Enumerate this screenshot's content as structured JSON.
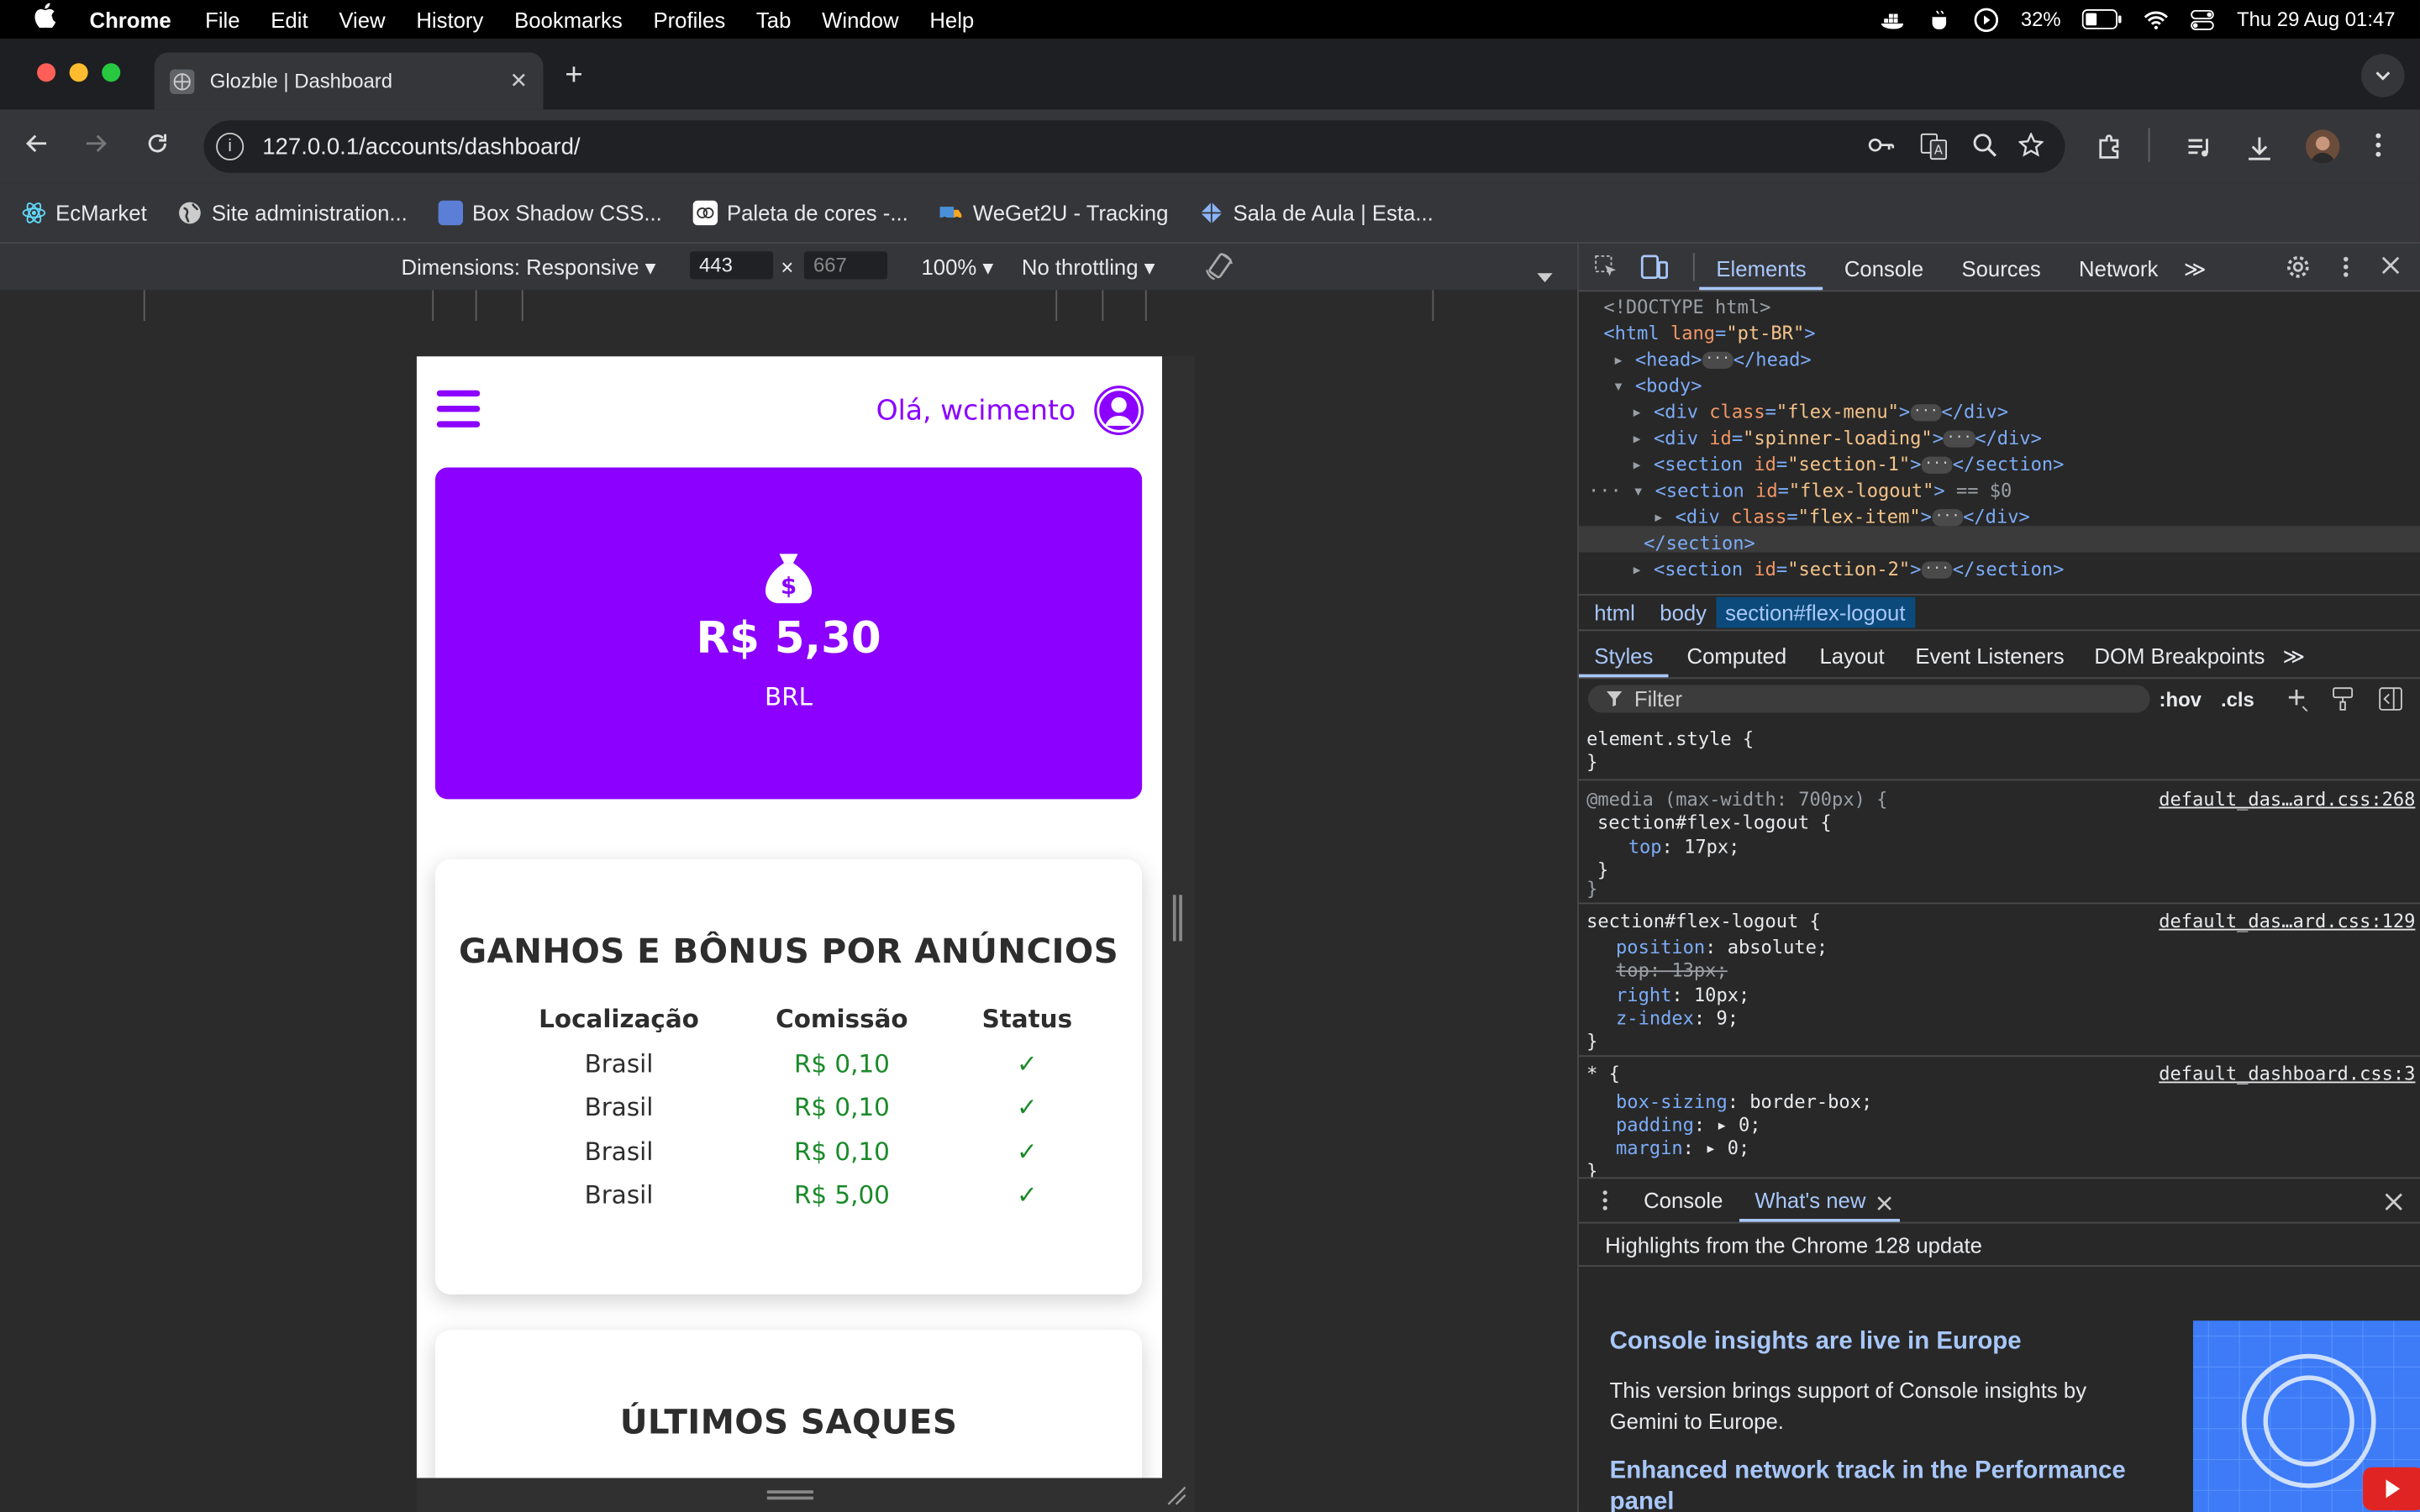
{
  "menubar": {
    "app": "Chrome",
    "items": [
      "File",
      "Edit",
      "View",
      "History",
      "Bookmarks",
      "Profiles",
      "Tab",
      "Window",
      "Help"
    ],
    "battery": "32%",
    "datetime": "Thu 29 Aug  01:47"
  },
  "tab": {
    "title": "Glozble | Dashboard",
    "close": "✕",
    "new": "+"
  },
  "address": {
    "url": "127.0.0.1/accounts/dashboard/"
  },
  "bookmarks": [
    "EcMarket",
    "Site administration...",
    "Box Shadow CSS...",
    "Paleta de cores -...",
    "WeGet2U - Tracking",
    "Sala de Aula | Esta..."
  ],
  "device_toolbar": {
    "dimensions": "Dimensions: Responsive ▾",
    "width": "443",
    "times": "×",
    "height": "667",
    "zoom": "100% ▾",
    "throttle": "No throttling ▾"
  },
  "site": {
    "greeting": "Olá, wcimento",
    "balance": {
      "amount": "R$ 5,30",
      "currency": "BRL"
    },
    "earnings": {
      "title": "GANHOS E BÔNUS POR ANÚNCIOS",
      "headers": [
        "Localização",
        "Comissão",
        "Status"
      ],
      "rows": [
        [
          "Brasil",
          "R$ 0,10",
          "✓"
        ],
        [
          "Brasil",
          "R$ 0,10",
          "✓"
        ],
        [
          "Brasil",
          "R$ 0,10",
          "✓"
        ],
        [
          "Brasil",
          "R$ 5,00",
          "✓"
        ]
      ]
    },
    "withdrawals": {
      "title": "ÚLTIMOS SAQUES"
    }
  },
  "devtools": {
    "tabs": [
      "Elements",
      "Console",
      "Sources",
      "Network",
      "≫"
    ],
    "dom": [
      "<!DOCTYPE html>",
      "<html lang=\"pt-BR\">",
      "<head> … </head>",
      "<body>",
      "<div class=\"flex-menu\"> … </div>",
      "<div id=\"spinner-loading\"> … </div>",
      "<section id=\"section-1\"> … </section>",
      "<section id=\"flex-logout\"> == $0",
      "<div class=\"flex-item\"> … </div>",
      "</section>",
      "<section id=\"section-2\"> … </section>"
    ],
    "breadcrumbs": [
      "html",
      "body",
      "section#flex-logout"
    ],
    "subtabs": [
      "Styles",
      "Computed",
      "Layout",
      "Event Listeners",
      "DOM Breakpoints",
      "≫"
    ],
    "filter_placeholder": "Filter",
    "hov": ":hov",
    "cls": ".cls",
    "styles": {
      "element_style": "element.style {",
      "media": "@media (max-width: 700px) {",
      "media_rule": "section#flex-logout {",
      "media_prop": "top: 17px;",
      "media_src": "default_das…ard.css:268",
      "rule2": "section#flex-logout {",
      "rule2_props": [
        "position: absolute;",
        "top: 13px;",
        "right: 10px;",
        "z-index: 9;"
      ],
      "rule2_src": "default_das…ard.css:129",
      "rule3": "* {",
      "rule3_props": [
        "box-sizing: border-box;",
        "padding: ▸ 0;",
        "margin: ▸ 0;"
      ],
      "rule3_src": "default_dashboard.css:3"
    },
    "drawer": {
      "tabs": [
        "Console",
        "What's new"
      ],
      "header": "Highlights from the Chrome 128 update",
      "item1_title": "Console insights are live in Europe",
      "item1_text": "This version brings support of Console insights by Gemini to Europe.",
      "item2_title": "Enhanced network track in the Performance panel"
    }
  }
}
